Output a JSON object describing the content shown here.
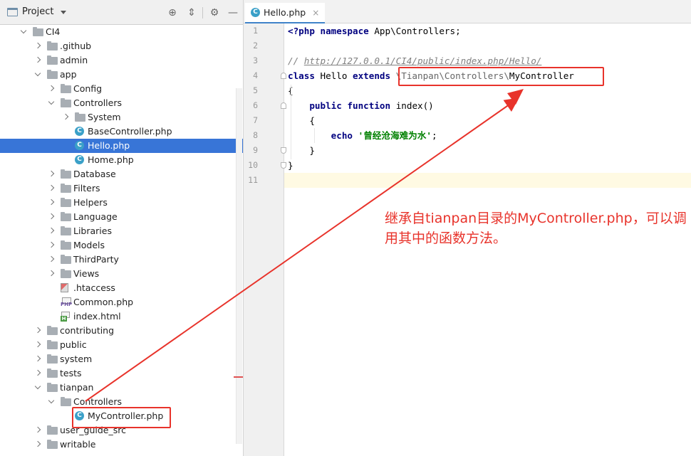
{
  "project_panel": {
    "title": "Project",
    "header_icons": [
      "locate-target-icon",
      "collapse-all-icon",
      "gear-icon",
      "hide-panel-icon"
    ],
    "tree": [
      {
        "label": "CI4",
        "type": "folder",
        "depth": 1,
        "state": "open"
      },
      {
        "label": ".github",
        "type": "folder",
        "depth": 2,
        "state": "closed"
      },
      {
        "label": "admin",
        "type": "folder",
        "depth": 2,
        "state": "closed"
      },
      {
        "label": "app",
        "type": "folder",
        "depth": 2,
        "state": "open"
      },
      {
        "label": "Config",
        "type": "folder",
        "depth": 3,
        "state": "closed"
      },
      {
        "label": "Controllers",
        "type": "folder",
        "depth": 3,
        "state": "open"
      },
      {
        "label": "System",
        "type": "folder",
        "depth": 4,
        "state": "closed"
      },
      {
        "label": "BaseController.php",
        "type": "class",
        "depth": 4,
        "state": "none"
      },
      {
        "label": "Hello.php",
        "type": "class",
        "depth": 4,
        "state": "none",
        "selected": true
      },
      {
        "label": "Home.php",
        "type": "class",
        "depth": 4,
        "state": "none"
      },
      {
        "label": "Database",
        "type": "folder",
        "depth": 3,
        "state": "closed"
      },
      {
        "label": "Filters",
        "type": "folder",
        "depth": 3,
        "state": "closed"
      },
      {
        "label": "Helpers",
        "type": "folder",
        "depth": 3,
        "state": "closed"
      },
      {
        "label": "Language",
        "type": "folder",
        "depth": 3,
        "state": "closed"
      },
      {
        "label": "Libraries",
        "type": "folder",
        "depth": 3,
        "state": "closed"
      },
      {
        "label": "Models",
        "type": "folder",
        "depth": 3,
        "state": "closed"
      },
      {
        "label": "ThirdParty",
        "type": "folder",
        "depth": 3,
        "state": "closed"
      },
      {
        "label": "Views",
        "type": "folder",
        "depth": 3,
        "state": "closed"
      },
      {
        "label": ".htaccess",
        "type": "htaccess",
        "depth": 3,
        "state": "none"
      },
      {
        "label": "Common.php",
        "type": "php",
        "depth": 3,
        "state": "none"
      },
      {
        "label": "index.html",
        "type": "html",
        "depth": 3,
        "state": "none"
      },
      {
        "label": "contributing",
        "type": "folder",
        "depth": 2,
        "state": "closed"
      },
      {
        "label": "public",
        "type": "folder",
        "depth": 2,
        "state": "closed"
      },
      {
        "label": "system",
        "type": "folder",
        "depth": 2,
        "state": "closed"
      },
      {
        "label": "tests",
        "type": "folder",
        "depth": 2,
        "state": "closed"
      },
      {
        "label": "tianpan",
        "type": "folder",
        "depth": 2,
        "state": "open"
      },
      {
        "label": "Controllers",
        "type": "folder",
        "depth": 3,
        "state": "open"
      },
      {
        "label": "MyController.php",
        "type": "class",
        "depth": 4,
        "state": "none"
      },
      {
        "label": "user_guide_src",
        "type": "folder",
        "depth": 2,
        "state": "closed"
      },
      {
        "label": "writable",
        "type": "folder",
        "depth": 2,
        "state": "closed"
      }
    ]
  },
  "editor": {
    "tab": {
      "label": "Hello.php",
      "icon": "php-class-icon",
      "close": "×"
    },
    "line_numbers": [
      "1",
      "2",
      "3",
      "4",
      "5",
      "6",
      "7",
      "8",
      "9",
      "10",
      "11"
    ],
    "current_line": 11,
    "lines": [
      [
        {
          "t": "<?php",
          "c": "kw"
        },
        {
          "t": " "
        },
        {
          "t": "namespace",
          "c": "kw"
        },
        {
          "t": " App\\Controllers;"
        }
      ],
      [],
      [
        {
          "t": "// ",
          "c": "cmt"
        },
        {
          "t": "http://127.0.0.1/CI4/public/index.php/Hello/",
          "c": "cmt-u"
        }
      ],
      [
        {
          "t": "class",
          "c": "kw"
        },
        {
          "t": " Hello "
        },
        {
          "t": "extends",
          "c": "kw"
        },
        {
          "t": " "
        },
        {
          "t": "\\Tianpan\\Controllers\\",
          "c": "ns"
        },
        {
          "t": "MyController"
        }
      ],
      [
        {
          "t": "{"
        }
      ],
      [
        {
          "t": "    "
        },
        {
          "t": "public",
          "c": "kw"
        },
        {
          "t": " "
        },
        {
          "t": "function",
          "c": "kw"
        },
        {
          "t": " index()"
        }
      ],
      [
        {
          "t": "    {"
        }
      ],
      [
        {
          "t": "        "
        },
        {
          "t": "echo",
          "c": "kw"
        },
        {
          "t": " "
        },
        {
          "t": "'曾经沧海难为水'",
          "c": "str"
        },
        {
          "t": ";"
        }
      ],
      [
        {
          "t": "    }"
        }
      ],
      [
        {
          "t": "}"
        }
      ],
      []
    ]
  },
  "annotation": {
    "text": "继承自tianpan目录的MyController.php，可以调用其中的函数方法。",
    "color": "#e8332b"
  },
  "colors": {
    "selection": "#3875d7",
    "keyword": "#000080",
    "string": "#008000",
    "comment": "#808080",
    "annotation_red": "#e8332b"
  }
}
